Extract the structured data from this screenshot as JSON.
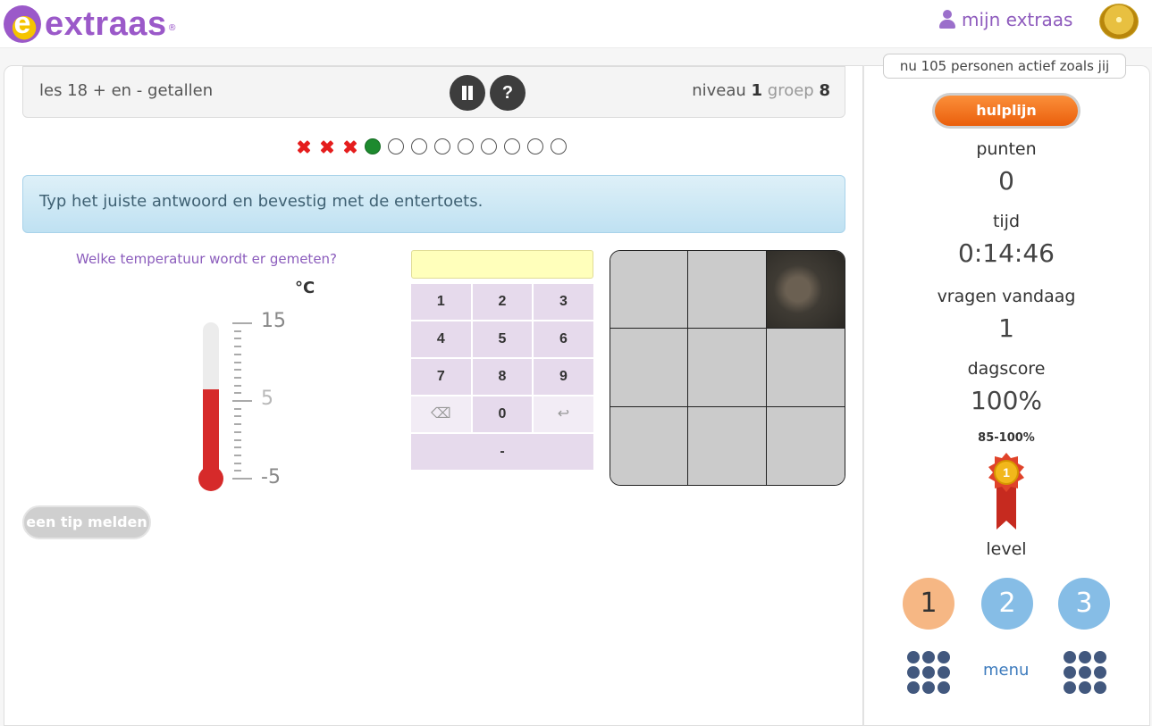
{
  "header": {
    "logo_text": "extraas",
    "logo_mark": "®",
    "user_link": "mijn extraas",
    "user_icon": "user-icon",
    "award_icon": "award-badge-icon"
  },
  "lesson": {
    "title": "les 18 + en - getallen",
    "niveau_label": "niveau",
    "niveau_value": "1",
    "groep_label": "groep",
    "groep_value": "8",
    "pause_icon": "pause-icon",
    "help_label": "?"
  },
  "progress": {
    "states": [
      "wrong",
      "wrong",
      "wrong",
      "current",
      "empty",
      "empty",
      "empty",
      "empty",
      "empty",
      "empty",
      "empty",
      "empty"
    ]
  },
  "instruction": "Typ het juiste antwoord en bevestig met de entertoets.",
  "question": {
    "text": "Welke temperatuur wordt er gemeten?",
    "unit": "°C",
    "thermometer": {
      "labels": [
        "15",
        "5",
        "-5"
      ],
      "min": -5,
      "max": 15,
      "reading": 5
    },
    "answer_value": ""
  },
  "keypad": {
    "rows": [
      [
        "1",
        "2",
        "3"
      ],
      [
        "4",
        "5",
        "6"
      ],
      [
        "7",
        "8",
        "9"
      ],
      [
        "⌫",
        "0",
        "↩"
      ]
    ],
    "minus": "-",
    "backspace_icon": "backspace-icon",
    "undo_icon": "undo-icon"
  },
  "tip_button": "een tip melden",
  "puzzle": {
    "revealed_cells": [
      2
    ]
  },
  "sidebar": {
    "active_badge": "nu 105 personen actief zoals jij",
    "hulplijn": "hulplijn",
    "punten_label": "punten",
    "punten_value": "0",
    "tijd_label": "tijd",
    "tijd_value": "0:14:46",
    "vragen_label": "vragen vandaag",
    "vragen_value": "1",
    "dagscore_label": "dagscore",
    "dagscore_value": "100%",
    "range": "85-100%",
    "ribbon_number": "1",
    "level_label": "level",
    "levels": [
      "1",
      "2",
      "3"
    ],
    "menu": "menu",
    "grid_icon": "apps-grid-icon"
  },
  "colors": {
    "brand": "#9b59c9",
    "wrong": "#e51d1d",
    "current": "#1d8a2e",
    "thermometer": "#d62a2a",
    "hulplijn": "#ea5f0c",
    "level_active": "#f6b784",
    "level_inactive": "#86bde6"
  }
}
